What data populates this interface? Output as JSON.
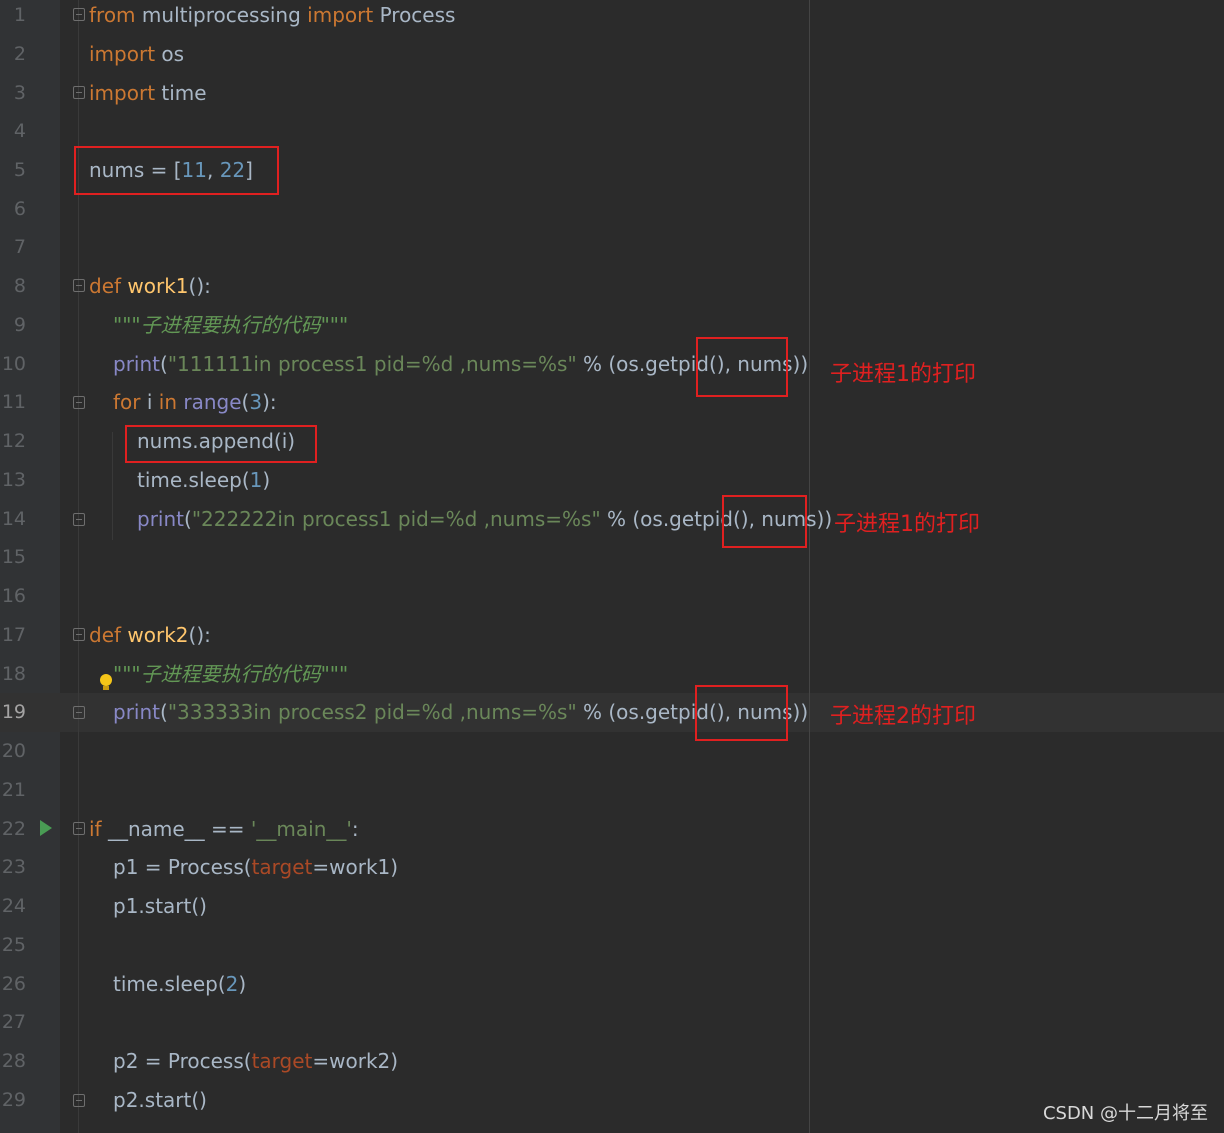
{
  "editor": {
    "line_numbers": [
      "1",
      "2",
      "3",
      "4",
      "5",
      "6",
      "7",
      "8",
      "9",
      "10",
      "11",
      "12",
      "13",
      "14",
      "15",
      "16",
      "17",
      "18",
      "19",
      "20",
      "21",
      "22",
      "23",
      "24",
      "25",
      "26",
      "27",
      "28",
      "29"
    ],
    "current_line": 19,
    "tokens": {
      "l1": [
        "from",
        " multiprocessing ",
        "import",
        " Process"
      ],
      "l2": [
        "import",
        " os"
      ],
      "l3": [
        "import",
        " time"
      ],
      "l5": [
        "nums = [",
        "11",
        ", ",
        "22",
        "]"
      ],
      "l8": [
        "def",
        " ",
        "work1",
        "():"
      ],
      "l9": "\"\"\"子进程要执行的代码\"\"\"",
      "l10": [
        "print",
        "(",
        "\"111111in process1 pid=%d ,nums=%s\"",
        " % (os.getpid(), nums))"
      ],
      "l11": [
        "for",
        " i ",
        "in",
        " ",
        "range",
        "(",
        "3",
        "):"
      ],
      "l12": "nums.append(i)",
      "l13": [
        "time.sleep(",
        "1",
        ")"
      ],
      "l14": [
        "print",
        "(",
        "\"222222in process1 pid=%d ,nums=%s\"",
        " % (os.getpid(), nums))"
      ],
      "l17": [
        "def",
        " ",
        "work2",
        "():"
      ],
      "l18": "\"\"\"子进程要执行的代码\"\"\"",
      "l19": [
        "print",
        "(",
        "\"333333in process2 pid=%d ,nums=%s\"",
        " % (os.getpid(), nums))"
      ],
      "l22": [
        "if",
        " __name__ == ",
        "'__main__'",
        ":"
      ],
      "l23": [
        "p1 = Process(",
        "target",
        "=work1)"
      ],
      "l24": "p1.start()",
      "l26": [
        "time.sleep(",
        "2",
        ")"
      ],
      "l28": [
        "p2 = Process(",
        "target",
        "=work2)"
      ],
      "l29": "p2.start()"
    }
  },
  "annotations": {
    "a1": "子进程1的打印",
    "a2": "子进程1的打印",
    "a3": "子进程2的打印"
  },
  "annotation_color": "#e02020",
  "watermark": "CSDN @十二月将至",
  "icons": [
    "run-icon",
    "bulb-icon",
    "fold-icon"
  ]
}
